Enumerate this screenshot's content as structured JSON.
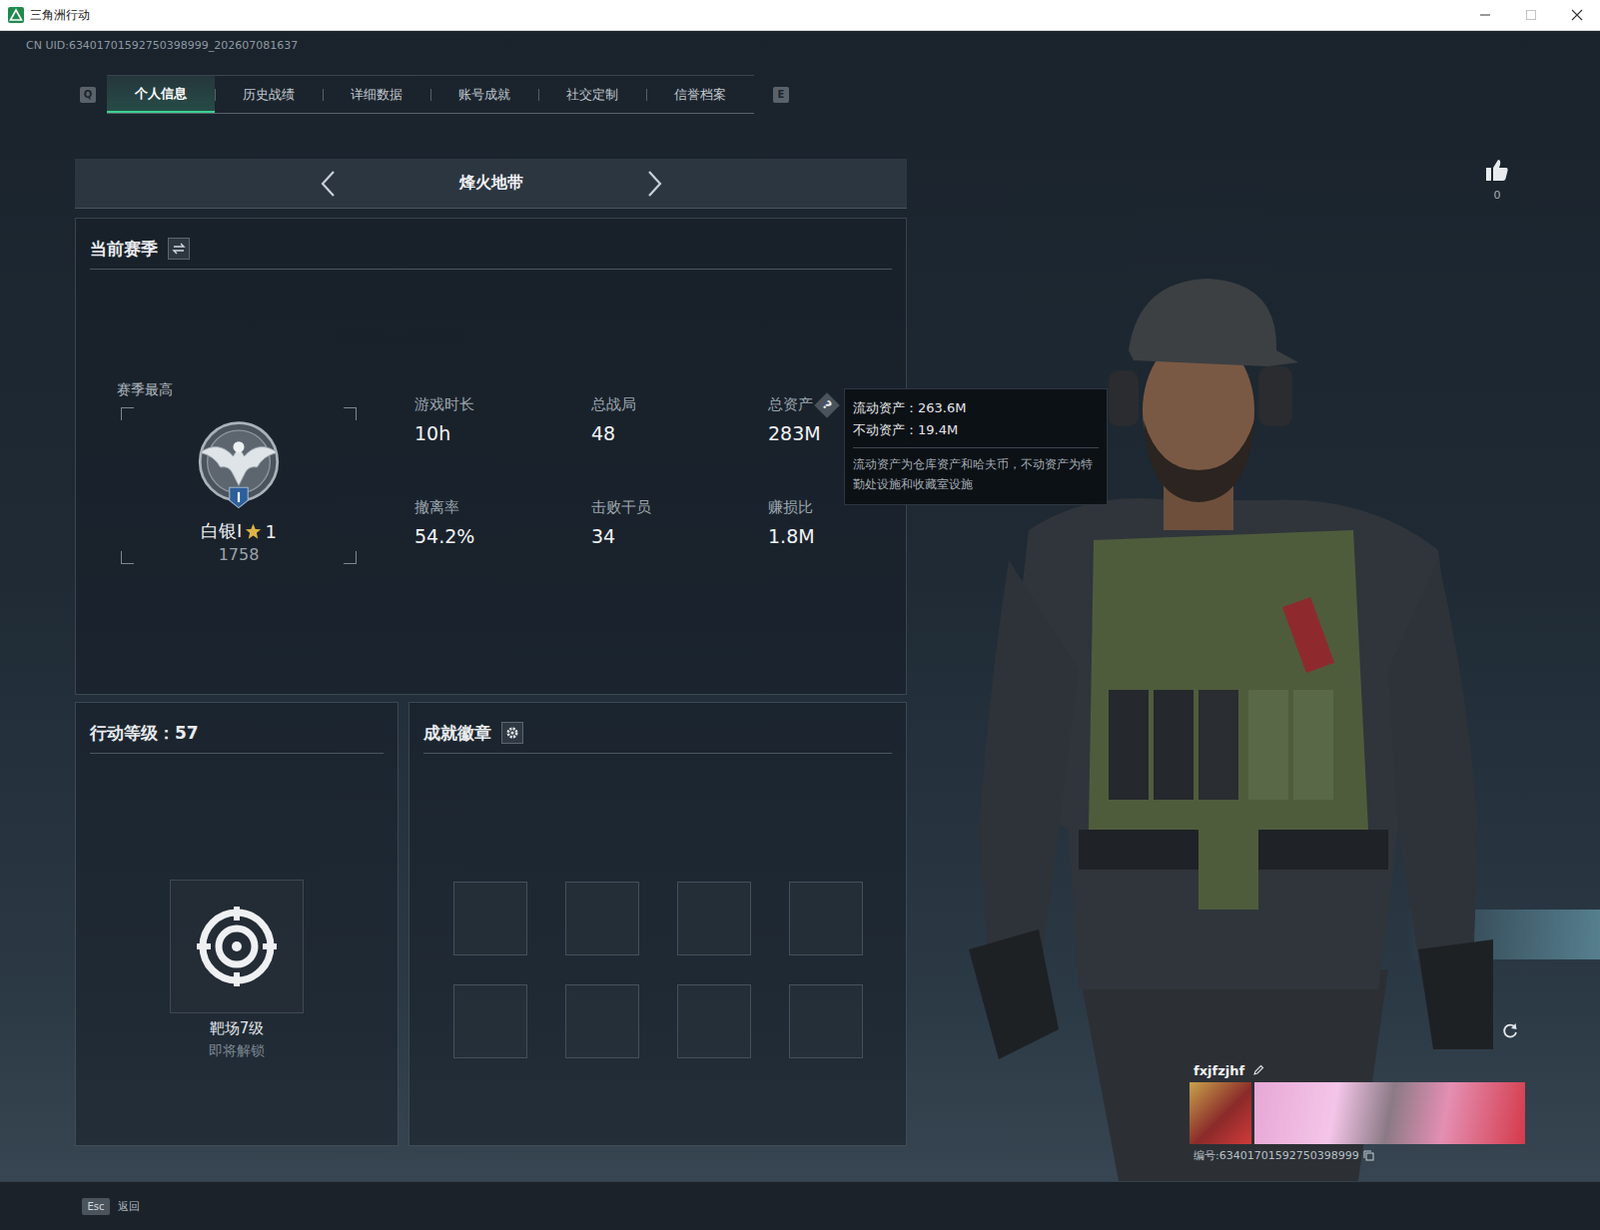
{
  "window": {
    "title": "三角洲行动",
    "maximize_enabled": false
  },
  "uid": "CN UID:63401701592750398999_202607081637",
  "tabs": {
    "prev_key": "Q",
    "next_key": "E",
    "items": [
      {
        "label": "个人信息",
        "selected": true
      },
      {
        "label": "历史战绩",
        "selected": false
      },
      {
        "label": "详细数据",
        "selected": false
      },
      {
        "label": "账号成就",
        "selected": false
      },
      {
        "label": "社交定制",
        "selected": false
      },
      {
        "label": "信誉档案",
        "selected": false
      }
    ]
  },
  "mode_selector": {
    "label": "烽火地带"
  },
  "season": {
    "title": "当前赛季",
    "best_label": "赛季最高",
    "rank": "白银I",
    "stars_text": "1",
    "score": "1758",
    "help_glyph": "?",
    "stats": [
      {
        "label": "游戏时长",
        "value": "10h",
        "help": false
      },
      {
        "label": "总战局",
        "value": "48",
        "help": false
      },
      {
        "label": "总资产",
        "value": "283M",
        "help": true
      },
      {
        "label": "撤离率",
        "value": "54.2%",
        "help": false
      },
      {
        "label": "击败干员",
        "value": "34",
        "help": false
      },
      {
        "label": "赚损比",
        "value": "1.8M",
        "help": false
      }
    ]
  },
  "tooltip": {
    "lines": [
      "流动资产：263.6M",
      "不动资产：19.4M"
    ],
    "note": "流动资产为仓库资产和哈夫币，不动资产为特勤处设施和收藏室设施"
  },
  "operation": {
    "title": "行动等级：57",
    "reward_name": "靶场7级",
    "reward_status": "即将解锁"
  },
  "achievements": {
    "title": "成就徽章",
    "slots": [
      {
        "filled": false
      },
      {
        "filled": false
      },
      {
        "filled": false
      },
      {
        "filled": false
      },
      {
        "filled": false
      },
      {
        "filled": false
      },
      {
        "filled": false
      },
      {
        "filled": false
      }
    ]
  },
  "likes": {
    "count": "0"
  },
  "player_card": {
    "name": "fxjfzjhf",
    "id": "编号:63401701592750398999"
  },
  "footer": {
    "key": "Esc",
    "label": "返回"
  }
}
